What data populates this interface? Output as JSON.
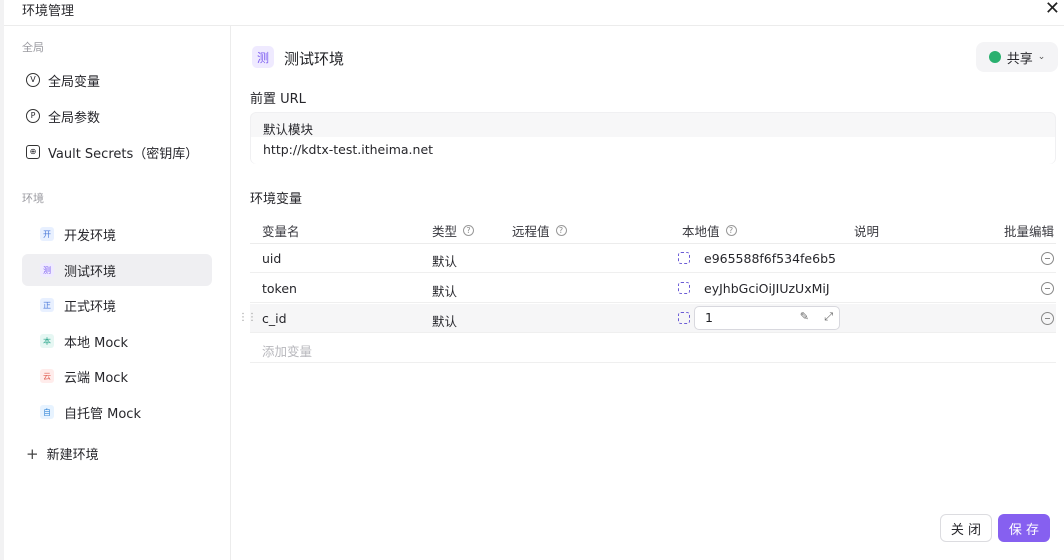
{
  "window": {
    "title": "环境管理"
  },
  "sidebar": {
    "global_section": "全局",
    "global_items": [
      {
        "label": "全局变量",
        "icon": "V"
      },
      {
        "label": "全局参数",
        "icon": "P"
      },
      {
        "label": "Vault Secrets（密钥库）",
        "icon": "vault-icon"
      }
    ],
    "env_section": "环境",
    "env_items": [
      {
        "label": "开发环境",
        "badge": "开",
        "color": "#e8f0ff",
        "fg": "#4a78d8"
      },
      {
        "label": "测试环境",
        "badge": "测",
        "color": "#efeaff",
        "fg": "#7b5cf0",
        "active": true
      },
      {
        "label": "正式环境",
        "badge": "正",
        "color": "#e8f0ff",
        "fg": "#4a78d8"
      },
      {
        "label": "本地 Mock",
        "badge": "本",
        "color": "#e6f7f3",
        "fg": "#2aa58a"
      },
      {
        "label": "云端 Mock",
        "badge": "云",
        "color": "#ffeceb",
        "fg": "#e05d52"
      },
      {
        "label": "自托管 Mock",
        "badge": "自",
        "color": "#e7f3ff",
        "fg": "#3a8ad8"
      }
    ],
    "new_env": "新建环境"
  },
  "main": {
    "env_badge": "测",
    "env_title": "测试环境",
    "share_label": "共享",
    "prefix_url_label": "前置 URL",
    "url_module": "默认模块",
    "url_value": "http://kdtx-test.itheima.net",
    "vars_label": "环境变量",
    "table": {
      "headers": {
        "name": "变量名",
        "type": "类型",
        "remote": "远程值",
        "local": "本地值",
        "desc": "说明",
        "bulk": "批量编辑"
      },
      "rows": [
        {
          "name": "uid",
          "type": "默认",
          "remote": "",
          "local": "e965588f6f534fe6b5",
          "desc": ""
        },
        {
          "name": "token",
          "type": "默认",
          "remote": "",
          "local": "eyJhbGciOiJIUzUxMiJ",
          "desc": ""
        },
        {
          "name": "c_id",
          "type": "默认",
          "remote": "",
          "local": "1",
          "desc": "",
          "editing": true
        }
      ],
      "add_placeholder": "添加变量"
    }
  },
  "footer": {
    "close_label": "关 闭",
    "save_label": "保 存"
  },
  "colors": {
    "accent": "#8660f0",
    "share_green": "#2ab06f"
  }
}
